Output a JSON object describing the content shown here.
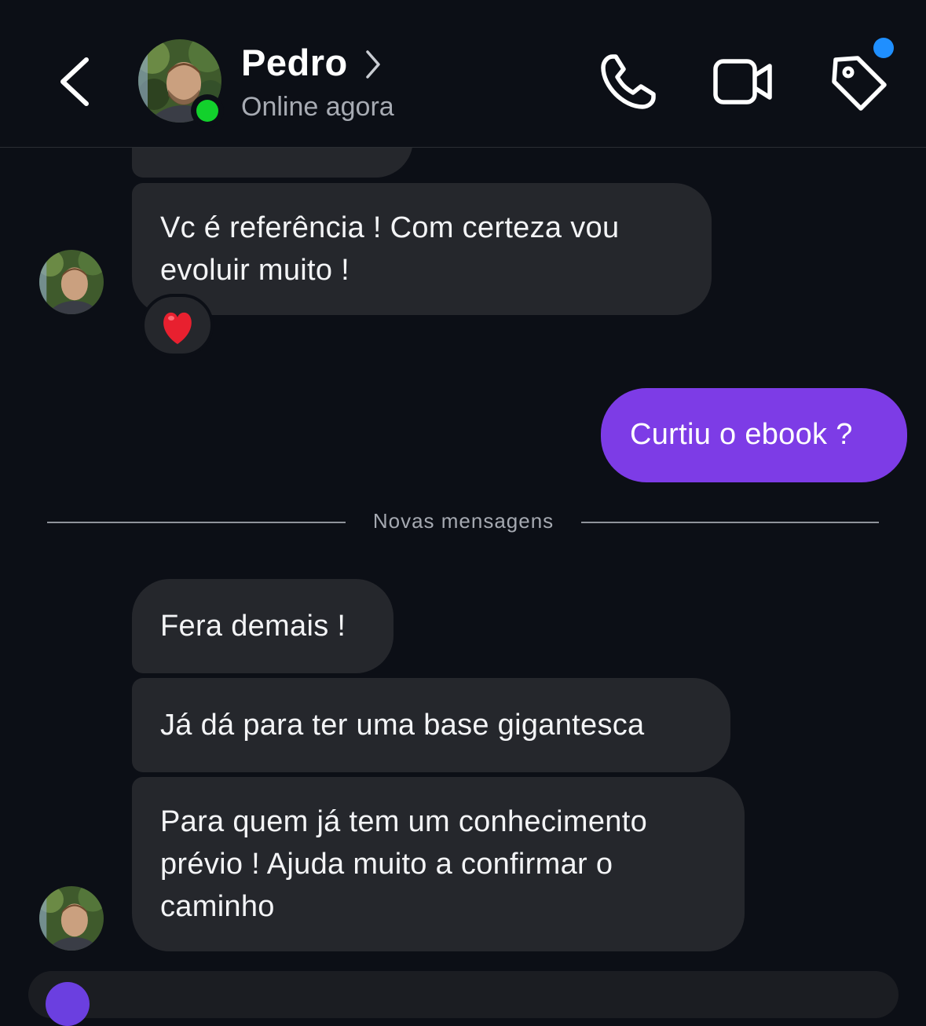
{
  "header": {
    "contact_name": "Pedro",
    "status": "Online agora",
    "icons": {
      "back": "chevron-left-icon",
      "call": "phone-icon",
      "video": "video-camera-icon",
      "tag": "tag-icon"
    },
    "online_color": "#12d12c",
    "notification_color": "#1f8fff"
  },
  "messages": [
    {
      "sender": "Pedro",
      "text": "Vc é referência ! Com certeza vou evoluir muito !",
      "reaction": "❤️"
    },
    {
      "sender": "me",
      "text": "Curtiu o ebook ?"
    },
    {
      "sender": "Pedro",
      "text": "Fera demais !"
    },
    {
      "sender": "Pedro",
      "text": "Já dá para ter uma base gigantesca"
    },
    {
      "sender": "Pedro",
      "text": "Para quem já tem um conhecimento prévio ! Ajuda muito a confirmar o caminho"
    }
  ],
  "divider": {
    "label": "Novas mensagens"
  },
  "colors": {
    "background": "#0c0f16",
    "their_bubble": "#25272c",
    "my_bubble": "#7d3ce6"
  }
}
